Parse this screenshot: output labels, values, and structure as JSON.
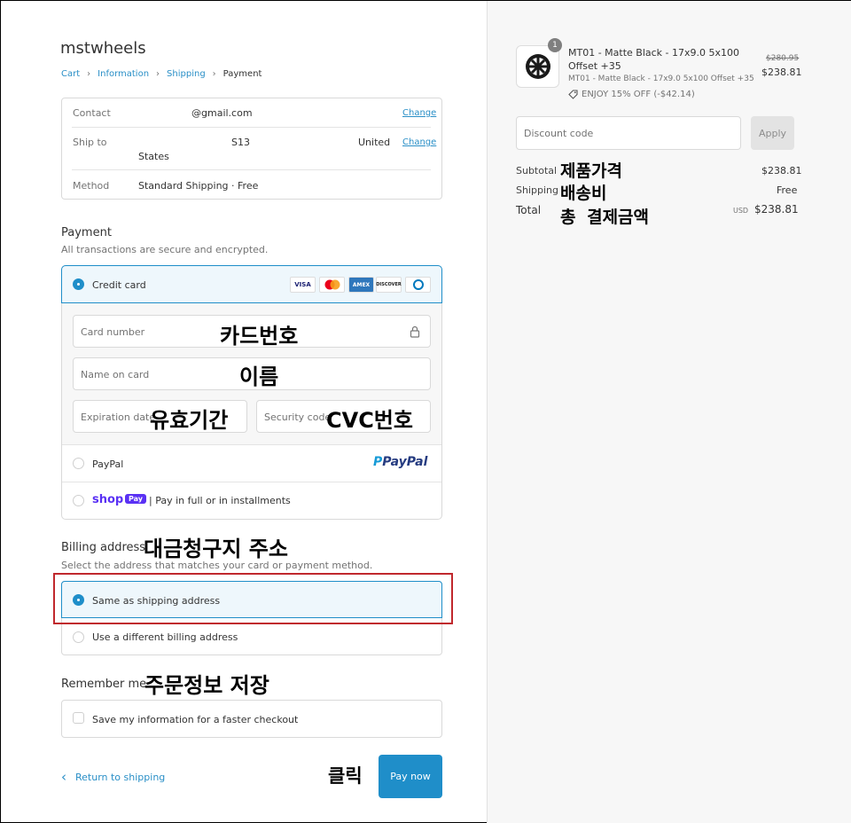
{
  "store": {
    "name": "mstwheels"
  },
  "breadcrumb": {
    "cart": "Cart",
    "information": "Information",
    "shipping": "Shipping",
    "payment": "Payment",
    "sep": "›"
  },
  "review": {
    "contact_label": "Contact",
    "contact_value": "@gmail.com",
    "ship_label": "Ship to",
    "ship_value_1": "S13",
    "ship_value_2": "United",
    "ship_value_3": "States",
    "method_label": "Method",
    "method_value": "Standard Shipping · Free",
    "change": "Change"
  },
  "payment": {
    "title": "Payment",
    "subtitle": "All transactions are secure and encrypted.",
    "credit_card": "Credit card",
    "card_logos": [
      "VISA",
      "",
      "AMEX",
      "DISCOVER",
      ""
    ],
    "card_number_placeholder": "Card number",
    "name_placeholder": "Name on card",
    "expiry_placeholder": "Expiration date",
    "security_placeholder": "Security code",
    "paypal_label": "PayPal",
    "paypal_logo": "PayPal",
    "shop_logo": "shop",
    "shop_pay_badge": "Pay",
    "shop_text": "| Pay in full or in installments"
  },
  "billing": {
    "title": "Billing address",
    "subtitle": "Select the address that matches your card or payment method.",
    "same": "Same as shipping address",
    "different": "Use a different billing address"
  },
  "remember": {
    "title": "Remember me",
    "save": "Save my information for a faster checkout"
  },
  "footer": {
    "return": "Return to shipping",
    "pay": "Pay now",
    "return_icon": "‹"
  },
  "annotations": {
    "card_number": "카드번호",
    "name": "이름",
    "expiry": "유효기간",
    "cvc": "CVC번호",
    "billing": "대금청구지 주소",
    "remember": "주문정보 저장",
    "click": "클릭",
    "subtotal": "제품가격",
    "shipping": "배송비",
    "total": "총 결제금액"
  },
  "summary": {
    "qty": "1",
    "product_title": "MT01 - Matte Black - 17x9.0 5x100",
    "product_title_2": "Offset +35",
    "product_variant": "MT01 - Matte Black - 17x9.0 5x100 Offset +35",
    "discount_tag": "ENJOY 15% OFF (-$42.14)",
    "original_price": "$280.95",
    "price": "$238.81",
    "discount_placeholder": "Discount code",
    "apply": "Apply",
    "subtotal_label": "Subtotal",
    "subtotal_value": "$238.81",
    "shipping_label": "Shipping",
    "shipping_value": "Free",
    "total_label": "Total",
    "currency": "USD",
    "total_value": "$238.81"
  },
  "colors": {
    "accent": "#1f8ec9",
    "highlight_border": "#c0282d",
    "selected_bg": "#eef7fc"
  }
}
